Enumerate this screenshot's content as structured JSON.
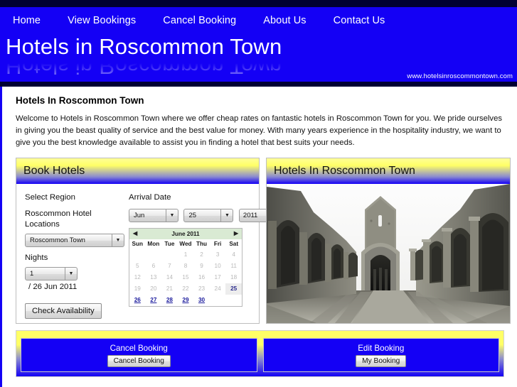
{
  "site": {
    "banner_title": "Hotels in Roscommon Town",
    "url": "www.hotelsinroscommontown.com"
  },
  "nav": {
    "items": [
      {
        "label": "Home"
      },
      {
        "label": "View Bookings"
      },
      {
        "label": "Cancel Booking"
      },
      {
        "label": "About Us"
      },
      {
        "label": "Contact Us"
      }
    ]
  },
  "main": {
    "heading": "Hotels In Roscommon Town",
    "intro": "Welcome to Hotels in Roscommon Town where we offer cheap rates on fantastic hotels in Roscommon Town for you. We pride ourselves in giving you the beast quality of service and the best value for money. With many years experience in the hospitality industry, we want to give you the best knowledge available to assist you in finding a hotel that best suits your needs."
  },
  "booking_panel": {
    "title": "Book Hotels",
    "select_region_label": "Select Region",
    "locations_label": "Roscommon Hotel Locations",
    "region_value": "Roscommon Town",
    "nights_label": "Nights",
    "nights_value": "1",
    "nights_suffix": "/ 26 Jun 2011",
    "check_button": "Check Availability",
    "arrival_date_label": "Arrival Date",
    "arrival_month": "Jun",
    "arrival_day": "25",
    "arrival_year": "2011"
  },
  "calendar": {
    "prev_icon": "◀",
    "next_icon": "▶",
    "title": "June 2011",
    "weekdays": [
      "Sun",
      "Mon",
      "Tue",
      "Wed",
      "Thu",
      "Fri",
      "Sat"
    ],
    "weeks": [
      [
        {
          "label": "",
          "state": "empty"
        },
        {
          "label": "",
          "state": "empty"
        },
        {
          "label": "",
          "state": "empty"
        },
        {
          "label": "1",
          "state": "disabled"
        },
        {
          "label": "2",
          "state": "disabled"
        },
        {
          "label": "3",
          "state": "disabled"
        },
        {
          "label": "4",
          "state": "disabled"
        }
      ],
      [
        {
          "label": "5",
          "state": "disabled"
        },
        {
          "label": "6",
          "state": "disabled"
        },
        {
          "label": "7",
          "state": "disabled"
        },
        {
          "label": "8",
          "state": "disabled"
        },
        {
          "label": "9",
          "state": "disabled"
        },
        {
          "label": "10",
          "state": "disabled"
        },
        {
          "label": "11",
          "state": "disabled"
        }
      ],
      [
        {
          "label": "12",
          "state": "disabled"
        },
        {
          "label": "13",
          "state": "disabled"
        },
        {
          "label": "14",
          "state": "disabled"
        },
        {
          "label": "15",
          "state": "disabled"
        },
        {
          "label": "16",
          "state": "disabled"
        },
        {
          "label": "17",
          "state": "disabled"
        },
        {
          "label": "18",
          "state": "disabled"
        }
      ],
      [
        {
          "label": "19",
          "state": "disabled"
        },
        {
          "label": "20",
          "state": "disabled"
        },
        {
          "label": "21",
          "state": "disabled"
        },
        {
          "label": "22",
          "state": "disabled"
        },
        {
          "label": "23",
          "state": "disabled"
        },
        {
          "label": "24",
          "state": "disabled"
        },
        {
          "label": "25",
          "state": "selected"
        }
      ],
      [
        {
          "label": "26",
          "state": "active"
        },
        {
          "label": "27",
          "state": "active"
        },
        {
          "label": "28",
          "state": "active"
        },
        {
          "label": "29",
          "state": "active"
        },
        {
          "label": "30",
          "state": "active"
        },
        {
          "label": "",
          "state": "empty"
        },
        {
          "label": "",
          "state": "empty"
        }
      ]
    ]
  },
  "photo_panel": {
    "title": "Hotels In Roscommon Town",
    "image_alt": "roscommon-abbey-ruins-photo"
  },
  "bottom": {
    "panels": [
      {
        "title": "Cancel Booking",
        "button": "Cancel Booking"
      },
      {
        "title": "Edit Booking",
        "button": "My Booking"
      }
    ]
  },
  "colors": {
    "brand_blue": "#1400f5",
    "dark_navy": "#000033",
    "accent_yellow": "#ffff66",
    "calendar_header_green": "#d9ead3"
  }
}
